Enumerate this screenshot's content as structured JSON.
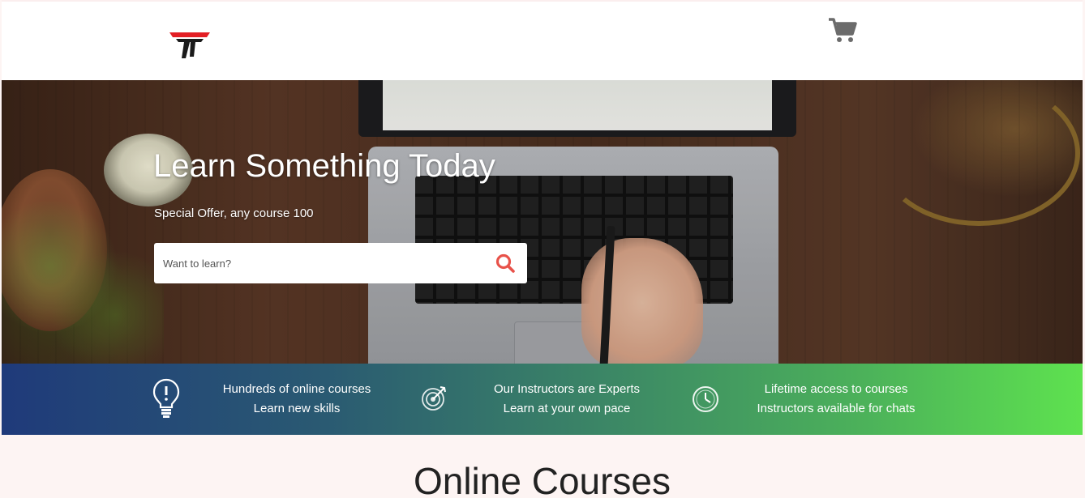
{
  "header": {
    "logo_icon": "tt-logo-icon",
    "cart_icon": "shopping-cart-icon"
  },
  "hero": {
    "title": "Learn Something Today",
    "subtitle": "Special Offer, any course 100",
    "search": {
      "placeholder": "Want to learn?",
      "value": "",
      "icon": "search-icon"
    }
  },
  "features": [
    {
      "icon": "lightbulb-icon",
      "line1": "Hundreds of online courses",
      "line2": "Learn new skills"
    },
    {
      "icon": "target-icon",
      "line1": "Our Instructors are Experts",
      "line2": "Learn at your own pace"
    },
    {
      "icon": "clock-icon",
      "line1": "Lifetime access to courses",
      "line2": "Instructors available for chats"
    }
  ],
  "section": {
    "title": "Online Courses"
  },
  "colors": {
    "logo_red": "#e31e24",
    "search_icon": "#e8524a",
    "band_start": "#1f3a7a",
    "band_end": "#5ee24f"
  }
}
